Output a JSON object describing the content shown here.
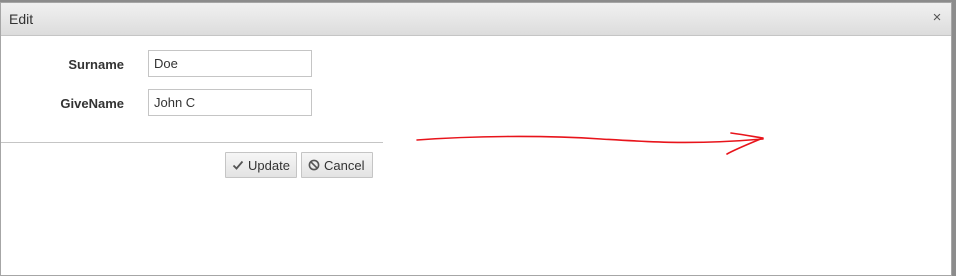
{
  "dialog": {
    "title": "Edit",
    "close_glyph": "×",
    "close_icon": "close-icon"
  },
  "form": {
    "surname_label": "Surname",
    "surname_value": "Doe",
    "givename_label": "GiveName",
    "givename_value": "John C"
  },
  "actions": {
    "update_label": "Update",
    "update_icon": "check-icon",
    "cancel_label": "Cancel",
    "cancel_icon": "cancel-circle-icon"
  },
  "colors": {
    "annotation_arrow": "#e8141b"
  }
}
